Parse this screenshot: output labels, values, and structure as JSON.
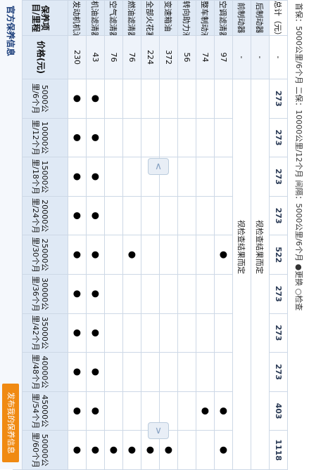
{
  "title": "官方保养信息",
  "publish_button": "发布我的保养信息",
  "legend": "首保：5000公里/6个月  二保：10000公里/12个月  间隔：5000公里/6个月  ●更换  ○检查",
  "header": {
    "name": "保养项目/里程",
    "price": "价格(元)",
    "intervals": [
      "5000公里/6个月",
      "10000公里/12个月",
      "15000公里/18个月",
      "20000公里/24个月",
      "25000公里/30个月",
      "30000公里/36个月",
      "35000公里/42个月",
      "40000公里/48个月",
      "45000公里/54个月",
      "50000公里/60个月"
    ]
  },
  "items": [
    {
      "name": "发动机机油",
      "price": "230",
      "marks": [
        "●",
        "●",
        "●",
        "●",
        "●",
        "●",
        "●",
        "●",
        "●",
        "●"
      ]
    },
    {
      "name": "机油滤清器",
      "price": "43",
      "marks": [
        "●",
        "●",
        "●",
        "●",
        "●",
        "●",
        "●",
        "●",
        "●",
        "●"
      ]
    },
    {
      "name": "空气滤清器",
      "price": "76",
      "marks": [
        "",
        "",
        "",
        "",
        "",
        "",
        "",
        "",
        "",
        "●"
      ]
    },
    {
      "name": "燃油滤清器",
      "price": "76",
      "marks": [
        "",
        "",
        "",
        "",
        "●",
        "",
        "",
        "",
        "",
        "●"
      ]
    },
    {
      "name": "全部火花塞",
      "price": "224",
      "marks": [
        "",
        "",
        "",
        "",
        "",
        "",
        "",
        "",
        "",
        "●"
      ]
    },
    {
      "name": "变速箱油（MT）",
      "price": "372",
      "marks": [
        "",
        "",
        "",
        "",
        "",
        "",
        "",
        "",
        "",
        "●"
      ]
    },
    {
      "name": "转向助力液",
      "price": "56",
      "marks": [
        "",
        "",
        "",
        "",
        "",
        "",
        "",
        "",
        "",
        ""
      ]
    },
    {
      "name": "整车制动液",
      "price": "74",
      "marks": [
        "",
        "",
        "",
        "",
        "",
        "",
        "",
        "",
        "●",
        ""
      ]
    },
    {
      "name": "空调滤清器",
      "price": "97",
      "marks": [
        "",
        "",
        "",
        "",
        "●",
        "",
        "",
        "",
        "●",
        "●"
      ]
    },
    {
      "name": "前制动器",
      "price": "-",
      "note": "视检查结果而定"
    },
    {
      "name": "后制动器",
      "price": "-",
      "note": "视检查结果而定"
    }
  ],
  "totals": {
    "name": "总计（元）",
    "price": "-",
    "values": [
      "273",
      "273",
      "273",
      "273",
      "522",
      "273",
      "273",
      "273",
      "403",
      "1118"
    ]
  },
  "scroll_up_icon": "chevron-up-icon",
  "scroll_down_icon": "chevron-down-icon"
}
